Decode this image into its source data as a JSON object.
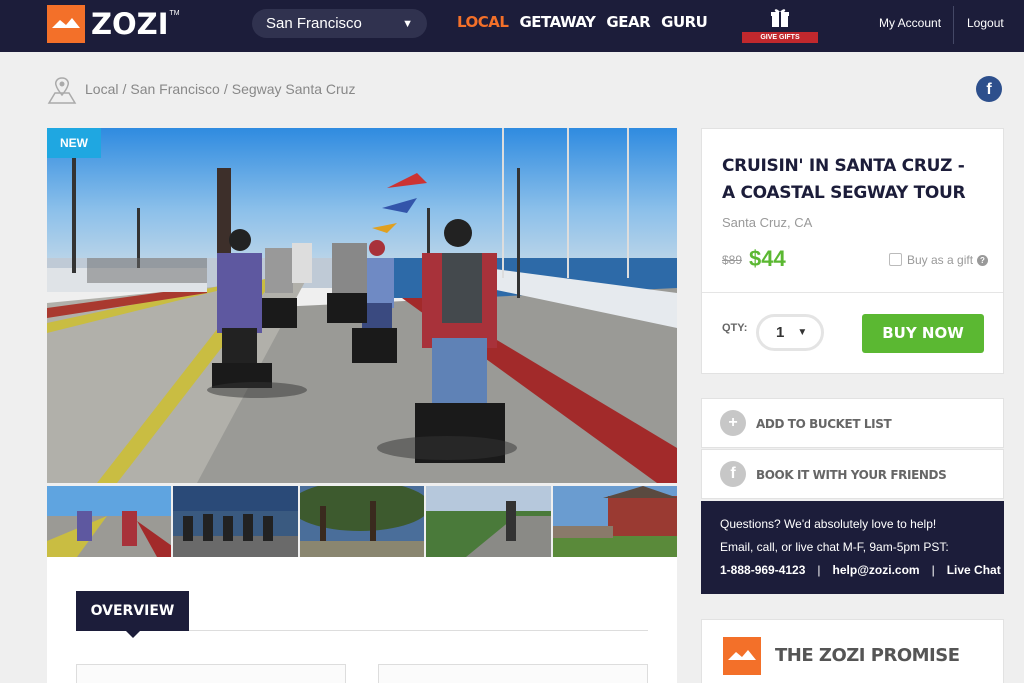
{
  "header": {
    "logo_text": "ZOZI",
    "logo_tm": "TM",
    "city": "San Francisco",
    "nav": [
      "LOCAL",
      "GETAWAY",
      "GEAR",
      "GURU"
    ],
    "active_nav": "LOCAL",
    "gifts_label": "GIVE GIFTS",
    "my_account": "My Account",
    "logout": "Logout",
    "colors": {
      "bar": "#1c1d3a",
      "accent": "#f37029",
      "gift_ribbon": "#c0282d"
    }
  },
  "breadcrumb": {
    "items": [
      "Local",
      "/",
      "San Francisco",
      "/",
      "Segway Santa Cruz"
    ]
  },
  "social": {
    "facebook_glyph": "f"
  },
  "gallery": {
    "badge": "NEW",
    "badge_color": "#1fa7e1",
    "hero_icon": "segway-pier-photo",
    "thumbnails": [
      "segway-pier-thumb",
      "segway-group-thumb",
      "cypress-trees-thumb",
      "coastal-path-thumb",
      "beach-house-thumb"
    ]
  },
  "overview": {
    "tab_label": "OVERVIEW"
  },
  "product": {
    "title": "CRUISIN' IN SANTA CRUZ - A COASTAL SEGWAY TOUR",
    "location": "Santa Cruz, CA",
    "old_price": "$89",
    "price": "$44",
    "price_color": "#5bb832",
    "gift_option": "Buy as a gift",
    "help_glyph": "?",
    "qty_label": "QTY:",
    "qty_value": "1",
    "buy_button": "BUY NOW"
  },
  "actions": {
    "bucket_icon": "+",
    "bucket_label": "ADD TO BUCKET LIST",
    "friends_icon": "f",
    "friends_label": "BOOK IT WITH YOUR FRIENDS"
  },
  "help": {
    "line1": "Questions? We'd absolutely love to help!",
    "line2": "Email, call, or live chat M-F, 9am-5pm PST:",
    "phone": "1-888-969-4123",
    "pipe": "|",
    "email": "help@zozi.com",
    "chat": "Live Chat"
  },
  "promise": {
    "title": "THE ZOZI PROMISE"
  }
}
